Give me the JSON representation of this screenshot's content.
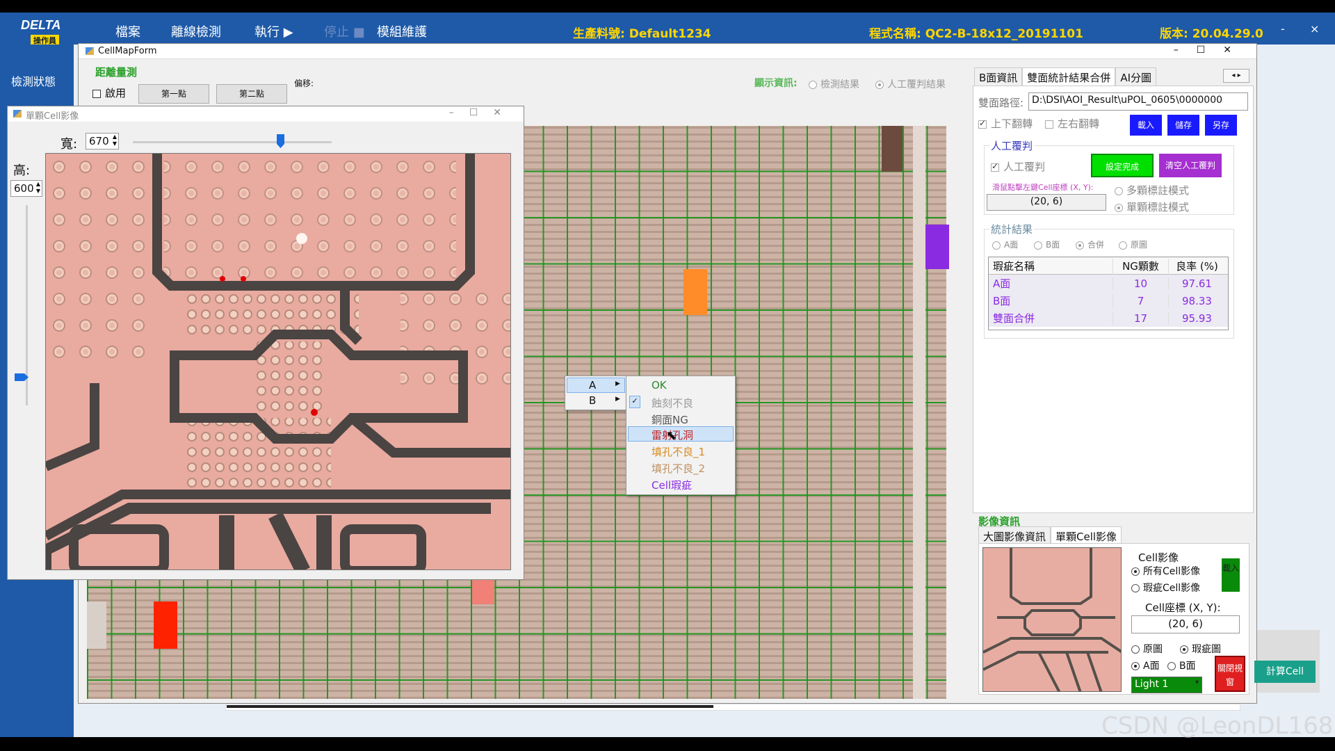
{
  "app": {
    "logo": "DELTA",
    "logo_sub": "操作員",
    "menu": [
      "檔案",
      "離線檢測",
      "執行 ▶",
      "停止 ■",
      "模組維護"
    ],
    "production_label": "生產料號: Default1234",
    "program_label": "程式名稱: QC2-B-18x12_20191101",
    "version_label": "版本: 20.04.29.0",
    "minimize": "-",
    "close": "×"
  },
  "sidebar": {
    "status_label": "檢測狀態"
  },
  "cellmap": {
    "title": "CellMapForm",
    "distance_group": "距離量測",
    "enable_label": "啟用",
    "first_point": "第一點",
    "second_point": "第二點",
    "offset_label": "偏移:",
    "display_info_label": "顯示資訊:",
    "display_options": [
      "檢測結果",
      "人工覆判結果"
    ],
    "display_selected": "人工覆判結果"
  },
  "right_panel": {
    "tabs": [
      "B面資訊",
      "雙面統計結果合併",
      "AI分圖"
    ],
    "active_tab": "雙面統計結果合併",
    "path_label": "雙面路徑:",
    "path_value": "D:\\DSI\\AOI_Result\\uPOL_0605\\0000000",
    "flip_vertical": "上下翻轉",
    "flip_horizontal": "左右翻轉",
    "load_btn": "載入",
    "save_btn": "儲存",
    "save_as_btn": "另存",
    "manual_group": "人工覆判",
    "manual_check": "人工覆判",
    "set_done_btn": "設定完成",
    "clear_manual_btn": "清空人工覆判",
    "hint": "滑鼠點擊左鍵Cell座標 (X, Y):",
    "coord_value": "(20, 6)",
    "multi_mode": "多顆標註模式",
    "single_mode": "單顆標註模式",
    "stats_group": "統計結果",
    "stats_options": [
      "A面",
      "B面",
      "合併",
      "原圖"
    ],
    "stats_selected": "合併",
    "table_headers": [
      "瑕疵名稱",
      "NG顆數",
      "良率 (%)"
    ],
    "table_rows": [
      {
        "name": "A面",
        "ng": "10",
        "yield": "97.61"
      },
      {
        "name": "B面",
        "ng": "7",
        "yield": "98.33"
      },
      {
        "name": "雙面合併",
        "ng": "17",
        "yield": "95.93"
      }
    ],
    "image_group": "影像資訊",
    "image_tabs": [
      "大圖影像資訊",
      "單顆Cell影像"
    ],
    "image_active_tab": "單顆Cell影像",
    "cell_image_label": "Cell影像",
    "all_cells": "所有Cell影像",
    "defect_cells": "瑕疵Cell影像",
    "load_small_btn": "載入",
    "cell_coord_label": "Cell座標 (X, Y):",
    "cell_coord_value": "(20, 6)",
    "orig_image": "原圖",
    "defect_image": "瑕疵圖",
    "side_a": "A面",
    "side_b": "B面",
    "close_window_btn": "關閉視窗",
    "light_value": "Light 1",
    "calc_cell_btn": "計算Cell"
  },
  "cell_window": {
    "title": "單顆Cell影像",
    "width_label": "寬:",
    "width_value": "670",
    "height_label": "高:",
    "height_value": "600",
    "slider_value": 0.75
  },
  "context_menu": {
    "sides": [
      "A",
      "B"
    ],
    "items": [
      "OK",
      "蝕刻不良",
      "銅面NG",
      "雷射孔洞",
      "填孔不良_1",
      "填孔不良_2",
      "Cell瑕疵"
    ],
    "checked_item": "蝕刻不良",
    "highlighted_item": "雷射孔洞"
  },
  "watermark": "CSDN @LeonDL168",
  "colors": {
    "topbar": "#1e5aa8",
    "accent_yellow": "#ffd600",
    "grid_green": "#1e961e",
    "ng_red": "#ff2200",
    "ng_pink": "#f08078",
    "ng_orange": "#ff8c28",
    "ng_purple": "#8a2be2"
  }
}
